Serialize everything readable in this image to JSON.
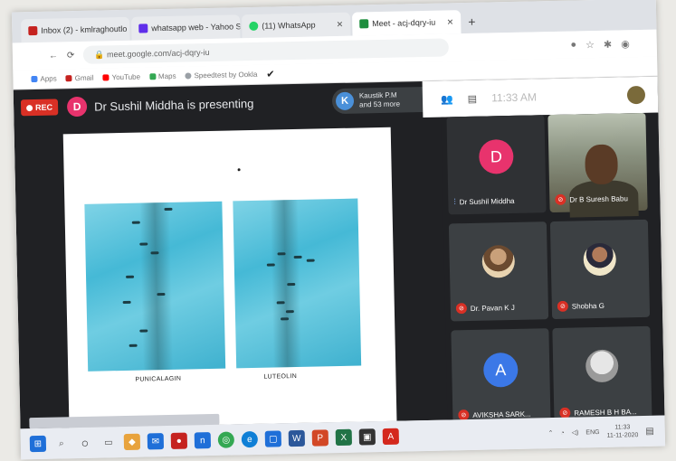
{
  "browser": {
    "tabs": [
      {
        "label": "Inbox (2) - kmlraghoutlo",
        "color": "#c5221f",
        "active": false
      },
      {
        "label": "whatsapp web - Yahoo Sea",
        "color": "#5f2eea",
        "active": false
      },
      {
        "label": "(11) WhatsApp",
        "color": "#25d366",
        "active": false
      },
      {
        "label": "Meet - acj-dqry-iu",
        "color": "#1e8e3e",
        "active": true
      }
    ],
    "new_tab_label": "+",
    "url": "meet.google.com/acj-dqry-iu",
    "bookmarks": [
      {
        "label": "Apps",
        "color": "#4285f4"
      },
      {
        "label": "Gmail",
        "color": "#c5221f"
      },
      {
        "label": "YouTube",
        "color": "#ff0000"
      },
      {
        "label": "Maps",
        "color": "#34a853"
      },
      {
        "label": "Speedtest by Ookla",
        "color": "#9aa0a6"
      }
    ]
  },
  "meet": {
    "rec_label": "REC",
    "presenter_initial": "D",
    "presenter_text": "Dr Sushil Middha is presenting",
    "participants_chip": {
      "initial": "K",
      "line1": "Kaustik P.M",
      "line2": "and 53 more"
    },
    "clock": "11:33 AM",
    "slide": {
      "left_caption": "PUNICALAGIN",
      "right_caption": "LUTEOLIN"
    },
    "tiles": [
      {
        "name": "Dr Sushil Middha",
        "initial": "D",
        "avatar_color": "#e8336d",
        "type": "initial",
        "speaking": true
      },
      {
        "name": "Dr B Suresh Babu",
        "type": "video",
        "speaking": false
      },
      {
        "name": "Dr. Pavan K J",
        "type": "photo",
        "speaking": false
      },
      {
        "name": "Shobha G",
        "type": "photo",
        "speaking": false
      },
      {
        "name": "AVIKSHA SARK...",
        "initial": "A",
        "avatar_color": "#3b78e7",
        "type": "initial",
        "speaking": false
      },
      {
        "name": "RAMESH B H BA...",
        "type": "photo",
        "speaking": false
      }
    ]
  },
  "taskbar": {
    "icons": [
      {
        "name": "start",
        "color": "#1f6fd8"
      },
      {
        "name": "search",
        "color": "#555555"
      },
      {
        "name": "cortana",
        "color": "#333333"
      },
      {
        "name": "task-view",
        "color": "#555555"
      },
      {
        "name": "app-1",
        "color": "#e8a33d"
      },
      {
        "name": "mail",
        "color": "#1f6fd8"
      },
      {
        "name": "app-2",
        "color": "#c5221f"
      },
      {
        "name": "app-3",
        "color": "#1f6fd8"
      },
      {
        "name": "chrome",
        "color": "#34a853"
      },
      {
        "name": "edge",
        "color": "#0f7fd6"
      },
      {
        "name": "app-4",
        "color": "#1f6fd8"
      },
      {
        "name": "word",
        "color": "#2b579a"
      },
      {
        "name": "powerpoint",
        "color": "#d24726"
      },
      {
        "name": "excel",
        "color": "#217346"
      },
      {
        "name": "store",
        "color": "#333333"
      },
      {
        "name": "acrobat",
        "color": "#d4281d"
      }
    ],
    "tray_lang": "ENG",
    "tray_time": "11:33",
    "tray_date": "11-11-2020"
  }
}
